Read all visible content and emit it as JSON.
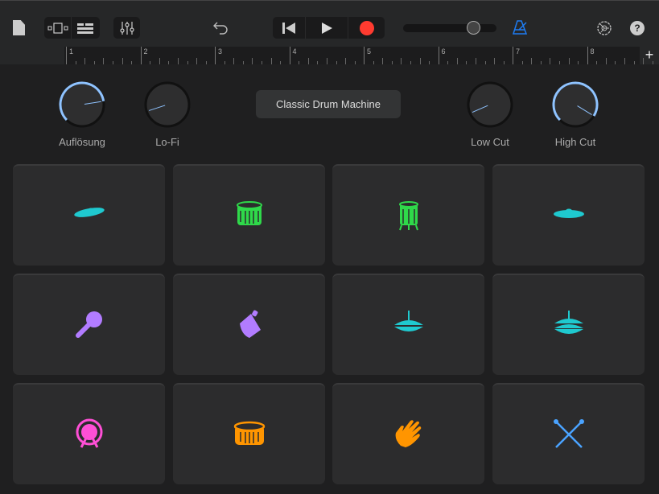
{
  "toolbar": {
    "tempo_slider_value": 0.8,
    "help_label": "?"
  },
  "ruler": {
    "bars": [
      "1",
      "2",
      "3",
      "4",
      "5",
      "6",
      "7",
      "8"
    ],
    "add_label": "+"
  },
  "knobs": [
    {
      "label": "Auflösung",
      "value": 0.8
    },
    {
      "label": "Lo-Fi",
      "value": 0.1
    },
    {
      "label": "Low Cut",
      "value": 0.08
    },
    {
      "label": "High Cut",
      "value": 0.95
    }
  ],
  "preset": {
    "label": "Classic Drum Machine"
  },
  "pads": [
    {
      "icon": "crash-cymbal-icon",
      "color": "#1fc9cf"
    },
    {
      "icon": "tom-drum-icon",
      "color": "#2fd94a"
    },
    {
      "icon": "floor-tom-icon",
      "color": "#2fd94a"
    },
    {
      "icon": "ride-cymbal-icon",
      "color": "#1fc9cf"
    },
    {
      "icon": "maraca-icon",
      "color": "#b27cff"
    },
    {
      "icon": "cowbell-icon",
      "color": "#b27cff"
    },
    {
      "icon": "closed-hihat-icon",
      "color": "#1fc9cf"
    },
    {
      "icon": "open-hihat-icon",
      "color": "#1fc9cf"
    },
    {
      "icon": "kick-drum-icon",
      "color": "#ff4fd6"
    },
    {
      "icon": "snare-drum-icon",
      "color": "#ff9500"
    },
    {
      "icon": "clap-icon",
      "color": "#ff9500"
    },
    {
      "icon": "sticks-icon",
      "color": "#4aa3ff"
    }
  ],
  "colors": {
    "accent": "#1e7cf2",
    "record": "#ff3b30",
    "knob_arc": "#8fc3ff"
  }
}
